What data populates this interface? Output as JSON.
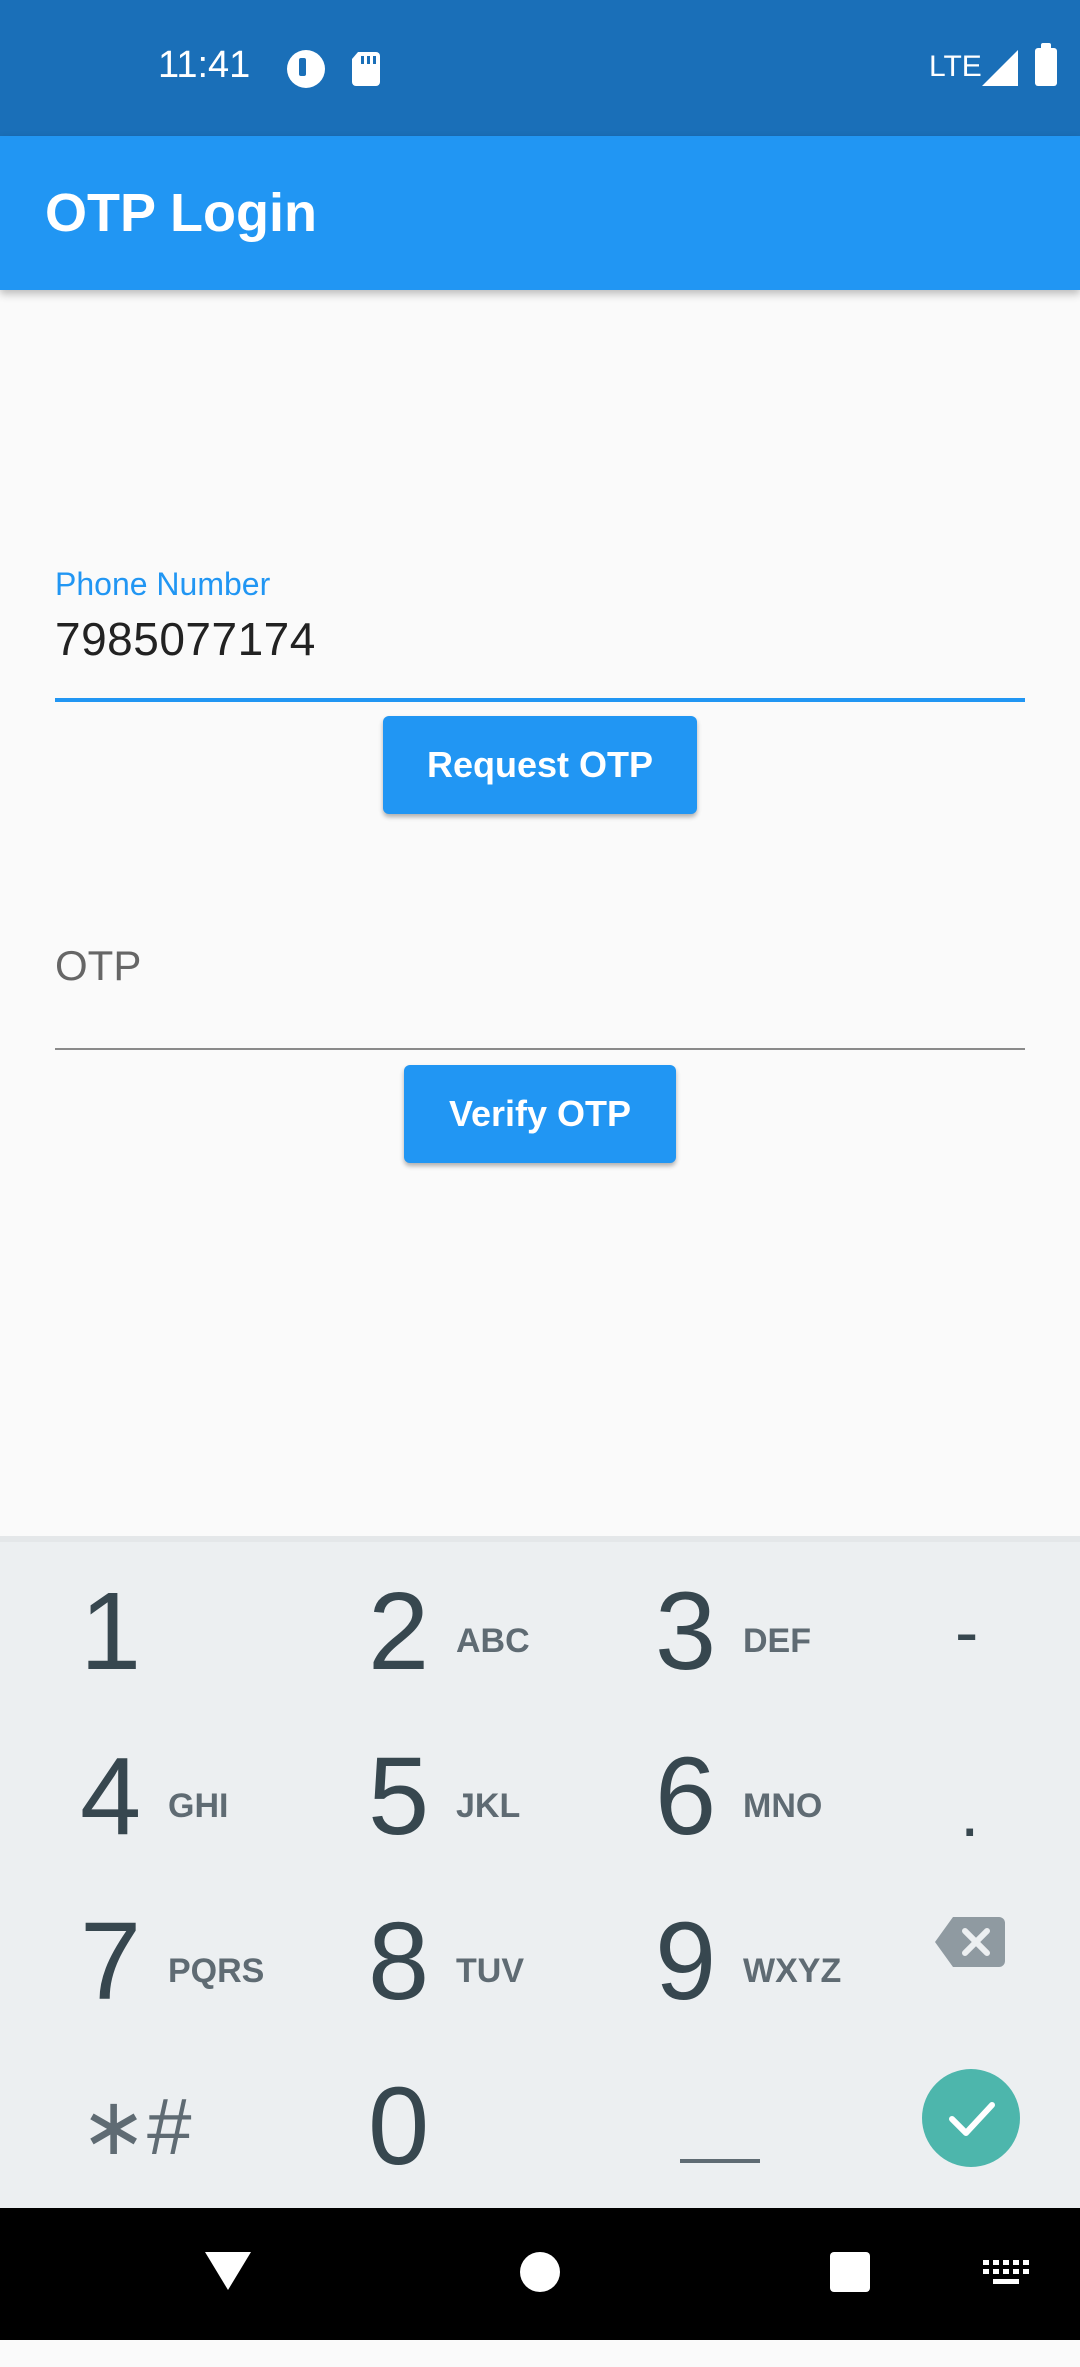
{
  "status_bar": {
    "time": "11:41",
    "network": "LTE"
  },
  "app_bar": {
    "title": "OTP Login"
  },
  "phone_field": {
    "label": "Phone Number",
    "value": "7985077174"
  },
  "request_button": {
    "label": "Request OTP"
  },
  "otp_field": {
    "placeholder": "OTP"
  },
  "verify_button": {
    "label": "Verify OTP"
  },
  "keyboard": {
    "keys": [
      {
        "digit": "1",
        "letters": ""
      },
      {
        "digit": "2",
        "letters": "ABC"
      },
      {
        "digit": "3",
        "letters": "DEF"
      },
      {
        "digit": "4",
        "letters": "GHI"
      },
      {
        "digit": "5",
        "letters": "JKL"
      },
      {
        "digit": "6",
        "letters": "MNO"
      },
      {
        "digit": "7",
        "letters": "PQRS"
      },
      {
        "digit": "8",
        "letters": "TUV"
      },
      {
        "digit": "9",
        "letters": "WXYZ"
      }
    ],
    "star_hash": "∗#",
    "zero_plus": "0 +",
    "dash": "-",
    "dot": ".",
    "enter_color": "#4db6ac"
  },
  "colors": {
    "primary": "#2196f3",
    "status_bar": "#1a6fb8"
  }
}
